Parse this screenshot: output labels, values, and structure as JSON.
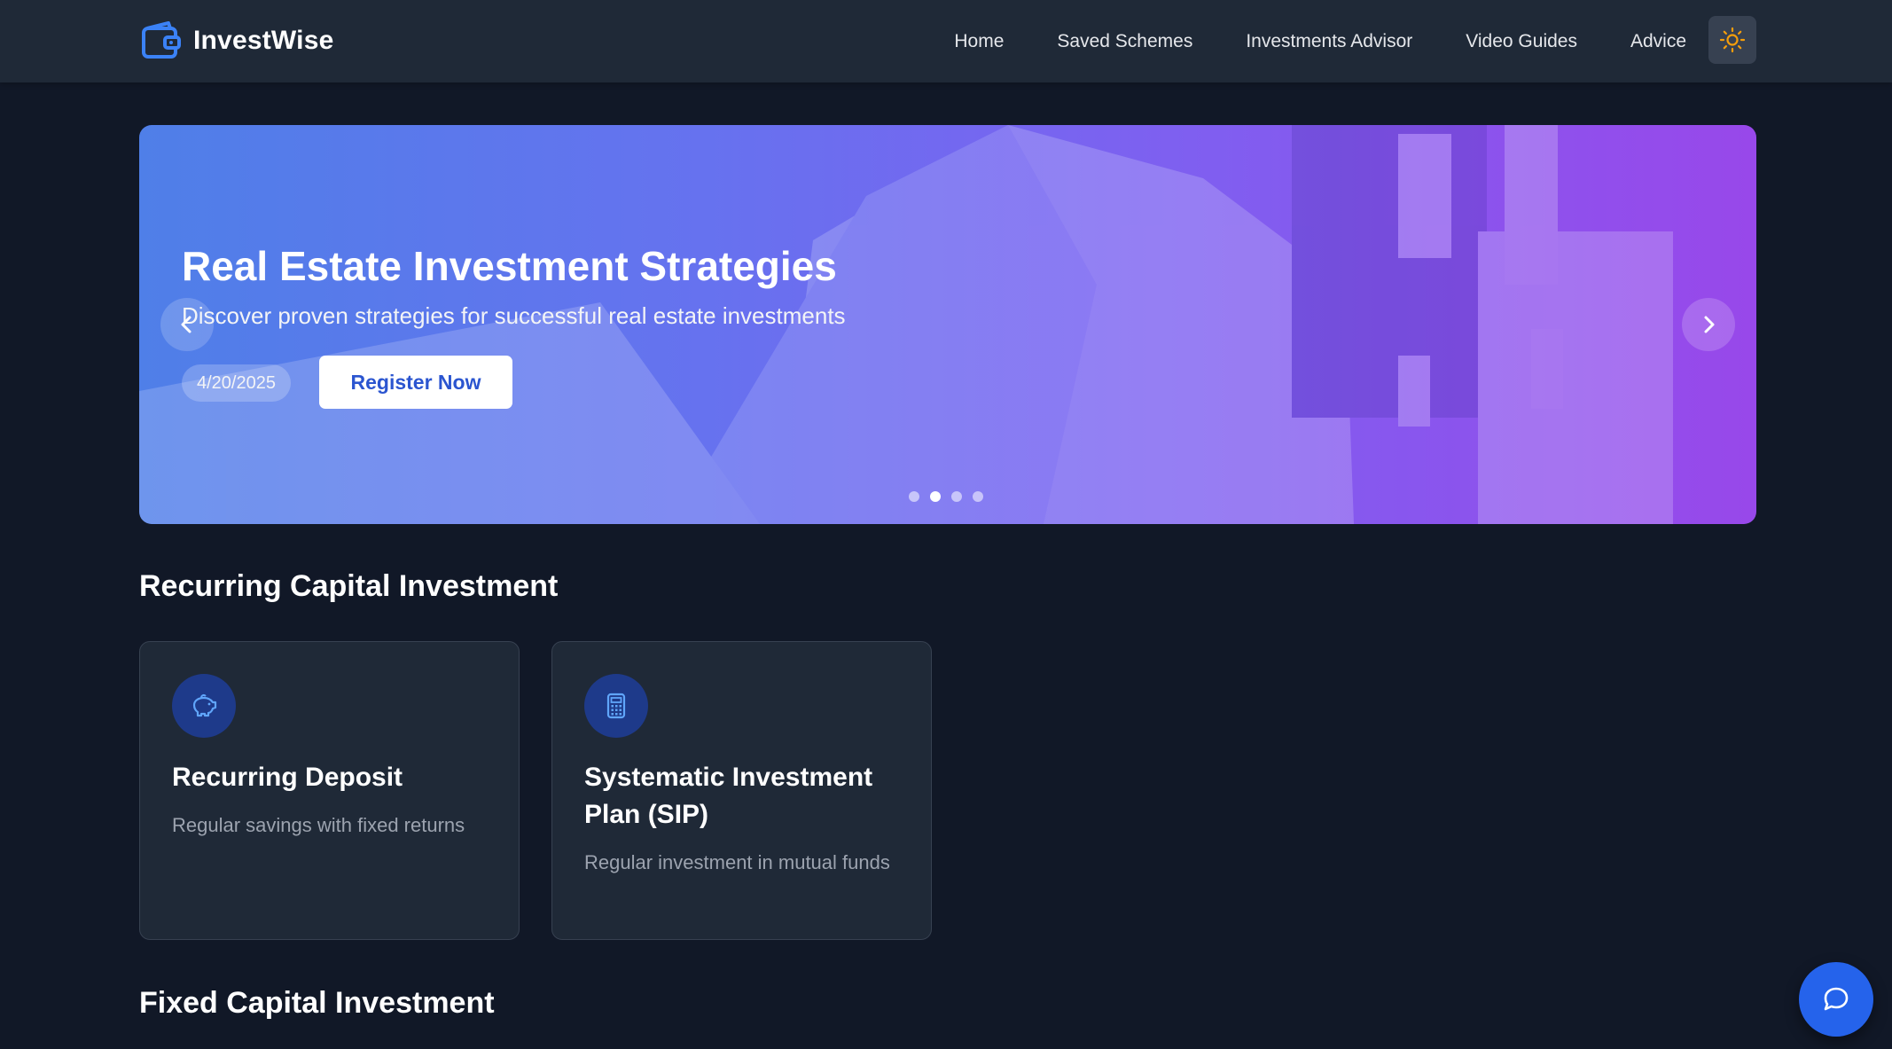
{
  "brand": {
    "name": "InvestWise",
    "icon": "wallet-icon"
  },
  "nav": {
    "links": [
      "Home",
      "Saved Schemes",
      "Investments Advisor",
      "Video Guides",
      "Advice"
    ],
    "theme_toggle_icon": "sun-icon"
  },
  "hero": {
    "title": "Real Estate Investment Strategies",
    "subtitle": "Discover proven strategies for successful real estate investments",
    "date": "4/20/2025",
    "cta": "Register Now",
    "slide_count": 4,
    "active_slide": 2
  },
  "sections": [
    {
      "title": "Recurring Capital Investment",
      "cards": [
        {
          "icon": "piggy-bank-icon",
          "title": "Recurring Deposit",
          "description": "Regular savings with fixed returns"
        },
        {
          "icon": "calculator-icon",
          "title": "Systematic Investment Plan (SIP)",
          "description": "Regular investment in mutual funds"
        }
      ]
    },
    {
      "title": "Fixed Capital Investment"
    }
  ],
  "chat": {
    "icon": "chat-icon"
  },
  "colors": {
    "background": "#111827",
    "navbar": "#1f2937",
    "card": "#1f2937",
    "accent": "#2563eb",
    "sun": "#f59e0b",
    "hero_gradient_start": "#4f7fe8",
    "hero_gradient_end": "#9848ea"
  }
}
